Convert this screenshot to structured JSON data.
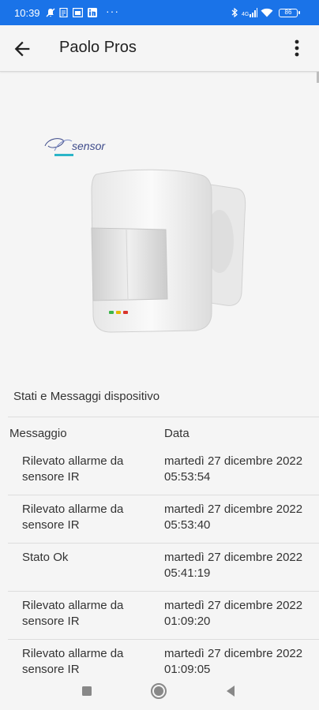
{
  "status_bar": {
    "time": "10:39",
    "battery": "86"
  },
  "app_bar": {
    "title": "Paolo Pros"
  },
  "brand": {
    "logo_text": "sensor"
  },
  "section": {
    "title": "Stati e Messaggi dispositivo"
  },
  "table": {
    "headers": {
      "message": "Messaggio",
      "date": "Data"
    },
    "rows": [
      {
        "message": "Rilevato allarme da sensore IR",
        "date": "martedì 27 dicembre 2022 05:53:54"
      },
      {
        "message": "Rilevato allarme da sensore IR",
        "date": "martedì 27 dicembre 2022 05:53:40"
      },
      {
        "message": "Stato Ok",
        "date": "martedì 27 dicembre 2022 05:41:19"
      },
      {
        "message": "Rilevato allarme da sensore IR",
        "date": "martedì 27 dicembre 2022 01:09:20"
      },
      {
        "message": "Rilevato allarme da sensore IR",
        "date": "martedì 27 dicembre 2022 01:09:05"
      }
    ]
  },
  "colors": {
    "status_bar": "#1a73e8",
    "background": "#f5f5f5",
    "logo_accent": "#2bb5c8"
  },
  "icons": [
    "back-arrow-icon",
    "more-vert-icon",
    "bluetooth-icon",
    "signal-icon",
    "wifi-icon",
    "battery-icon",
    "nav-recents-icon",
    "nav-home-icon",
    "nav-back-icon"
  ]
}
